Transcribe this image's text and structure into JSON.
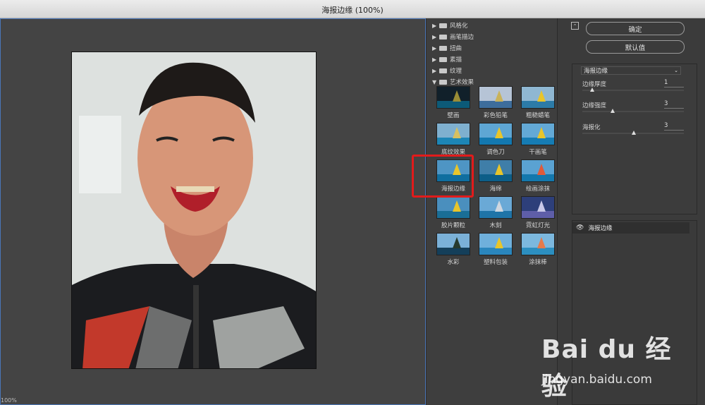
{
  "window": {
    "title": "海报边缘 (100%)"
  },
  "preview": {
    "zoom": "100%"
  },
  "gallery": {
    "categories": [
      {
        "label": "风格化",
        "expanded": false
      },
      {
        "label": "画笔描边",
        "expanded": false
      },
      {
        "label": "扭曲",
        "expanded": false
      },
      {
        "label": "素描",
        "expanded": false
      },
      {
        "label": "纹理",
        "expanded": false
      },
      {
        "label": "艺术效果",
        "expanded": true
      }
    ],
    "thumbnails": [
      {
        "label": "壁画"
      },
      {
        "label": "彩色铅笔"
      },
      {
        "label": "粗糙蜡笔"
      },
      {
        "label": "底纹效果"
      },
      {
        "label": "调色刀"
      },
      {
        "label": "干画笔"
      },
      {
        "label": "海报边缘",
        "selected": true
      },
      {
        "label": "海绵"
      },
      {
        "label": "绘画涂抹"
      },
      {
        "label": "胶片颗粒"
      },
      {
        "label": "木刻"
      },
      {
        "label": "霓虹灯光"
      },
      {
        "label": "水彩"
      },
      {
        "label": "塑料包装"
      },
      {
        "label": "涂抹棒"
      }
    ]
  },
  "panel": {
    "ok_label": "确定",
    "default_label": "默认值",
    "filter_select": "海报边缘",
    "params": [
      {
        "label": "边缘厚度",
        "value": "1",
        "fraction": 0.1
      },
      {
        "label": "边缘强度",
        "value": "3",
        "fraction": 0.3
      },
      {
        "label": "海报化",
        "value": "3",
        "fraction": 0.5
      }
    ],
    "layer_name": "海报边缘"
  },
  "watermark": {
    "brand": "Bai du 经验",
    "url": "jingyan.baidu.com"
  },
  "colors": {
    "highlight_box": "#e21b1b",
    "preview_border": "#4a76b8"
  }
}
